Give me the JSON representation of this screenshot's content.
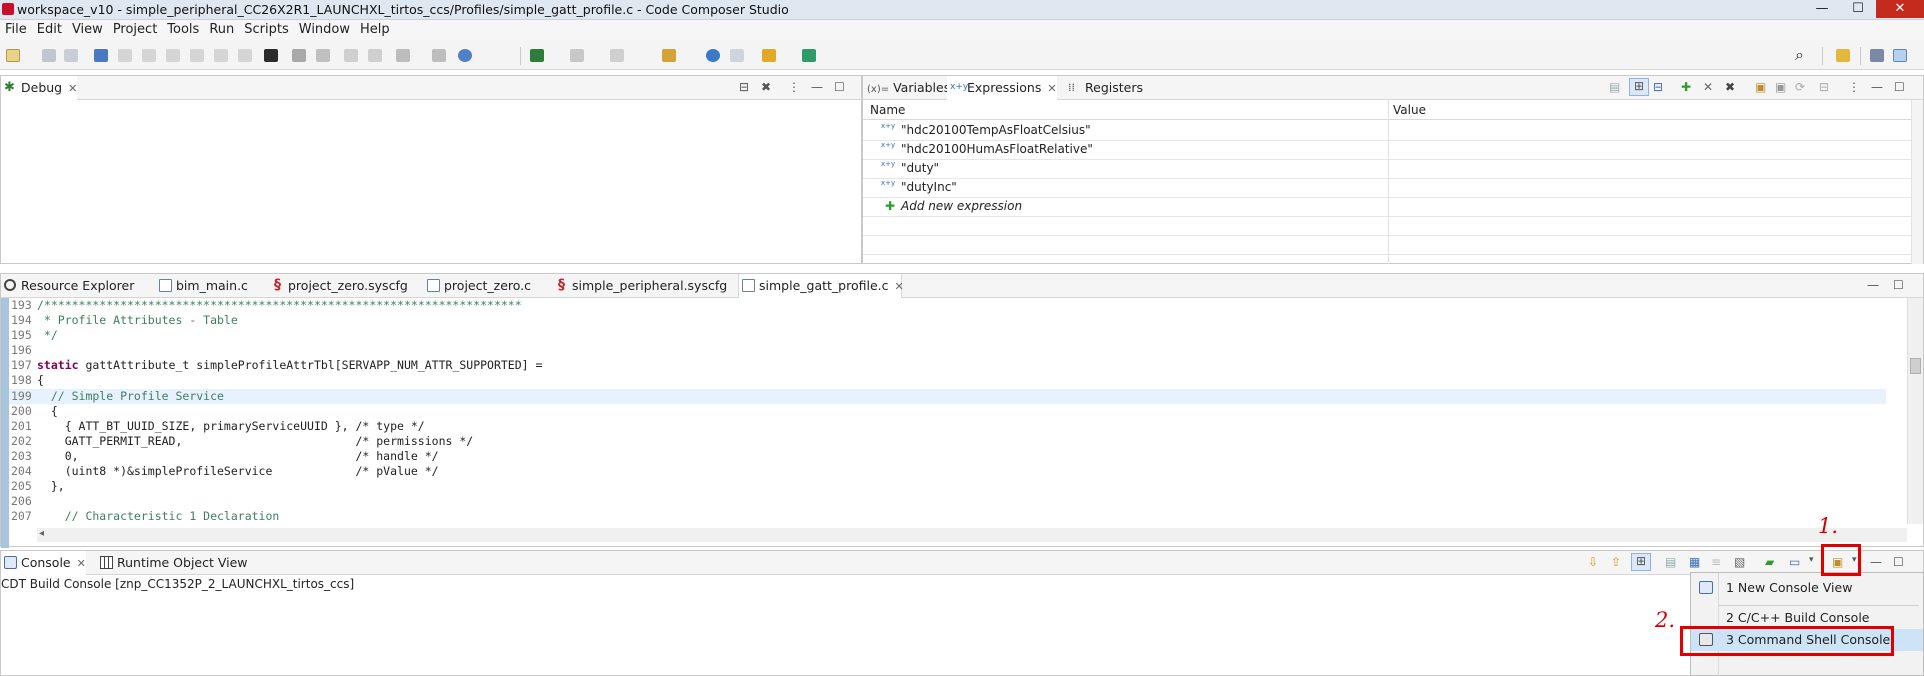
{
  "window": {
    "title": "workspace_v10 - simple_peripheral_CC26X2R1_LAUNCHXL_tirtos_ccs/Profiles/simple_gatt_profile.c - Code Composer Studio",
    "min_icon": "minimize-icon",
    "max_icon": "maximize-icon",
    "close_icon": "close-icon",
    "min_glyph": "—",
    "max_glyph": "☐",
    "close_glyph": "✕"
  },
  "menu": [
    "File",
    "Edit",
    "View",
    "Project",
    "Tools",
    "Run",
    "Scripts",
    "Window",
    "Help"
  ],
  "debug": {
    "tab_label": "Debug"
  },
  "expressions": {
    "tabs": [
      "Variables",
      "Expressions",
      "Registers"
    ],
    "tab_prefix": "(x)=",
    "col_name": "Name",
    "col_value": "Value",
    "rows": [
      "\"hdc20100TempAsFloatCelsius\"",
      "\"hdc20100HumAsFloatRelative\"",
      "\"duty\"",
      "\"dutyInc\""
    ],
    "add_label": "Add new expression",
    "xy_glyph": "x+y",
    "add_glyph": "✚"
  },
  "editor": {
    "tabs": [
      "Resource Explorer",
      "bim_main.c",
      "project_zero.syscfg",
      "project_zero.c",
      "simple_peripheral.syscfg",
      "simple_gatt_profile.c"
    ],
    "lines": [
      {
        "n": "193",
        "t": "/*********************************************************************"
      },
      {
        "n": "194",
        "t": " * Profile Attributes - Table"
      },
      {
        "n": "195",
        "t": " */"
      },
      {
        "n": "196",
        "t": ""
      },
      {
        "n": "197",
        "t": "static gattAttribute_t simpleProfileAttrTbl[SERVAPP_NUM_ATTR_SUPPORTED] ="
      },
      {
        "n": "198",
        "t": "{"
      },
      {
        "n": "199",
        "t": "  // Simple Profile Service"
      },
      {
        "n": "200",
        "t": "  {"
      },
      {
        "n": "201",
        "t": "    { ATT_BT_UUID_SIZE, primaryServiceUUID }, /* type */"
      },
      {
        "n": "202",
        "t": "    GATT_PERMIT_READ,                         /* permissions */"
      },
      {
        "n": "203",
        "t": "    0,                                        /* handle */"
      },
      {
        "n": "204",
        "t": "    (uint8 *)&simpleProfileService            /* pValue */"
      },
      {
        "n": "205",
        "t": "  },"
      },
      {
        "n": "206",
        "t": ""
      },
      {
        "n": "207",
        "t": "    // Characteristic 1 Declaration"
      }
    ]
  },
  "console": {
    "tabs": [
      "Console",
      "Runtime Object View"
    ],
    "text": "CDT Build Console [znp_CC1352P_2_LAUNCHXL_tirtos_ccs]",
    "menu_items": [
      "1 New Console View",
      "2 C/C++ Build Console",
      "3 Command Shell Console"
    ]
  },
  "annotations": [
    "1.",
    "2."
  ],
  "glyphs": {
    "close_x": "✕",
    "view_menu": "⋮",
    "minimize": "—",
    "maximize": "☐",
    "dropdown": "▾",
    "scroll_left": "◂",
    "search": "⌕"
  },
  "colors": {
    "highlight": "#e00000",
    "gutter": "#a9c5de",
    "current_line": "#e8f2fe"
  }
}
